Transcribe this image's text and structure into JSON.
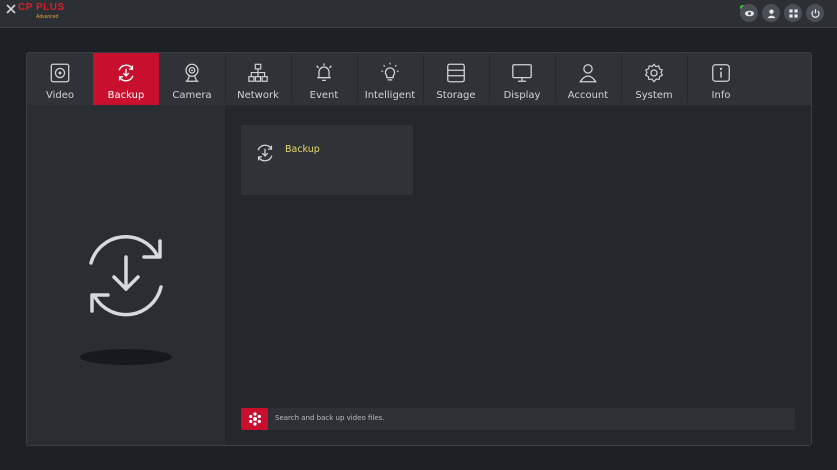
{
  "app": {
    "brand": "CP PLUS",
    "brand_sub": "Advanced"
  },
  "topbar": {
    "buttons": [
      {
        "icon": "eye-icon"
      },
      {
        "icon": "user-icon"
      },
      {
        "icon": "grid-icon"
      },
      {
        "icon": "power-icon"
      }
    ],
    "status_color": "#3ec93e"
  },
  "tabs": [
    {
      "label": "Video",
      "icon": "video-icon",
      "active": false
    },
    {
      "label": "Backup",
      "icon": "backup-icon",
      "active": true
    },
    {
      "label": "Camera",
      "icon": "camera-icon",
      "active": false
    },
    {
      "label": "Network",
      "icon": "network-icon",
      "active": false
    },
    {
      "label": "Event",
      "icon": "event-icon",
      "active": false
    },
    {
      "label": "Intelligent",
      "icon": "intelligent-icon",
      "active": false
    },
    {
      "label": "Storage",
      "icon": "storage-icon",
      "active": false
    },
    {
      "label": "Display",
      "icon": "display-icon",
      "active": false
    },
    {
      "label": "Account",
      "icon": "account-icon",
      "active": false
    },
    {
      "label": "System",
      "icon": "system-icon",
      "active": false
    },
    {
      "label": "Info",
      "icon": "info-icon",
      "active": false
    }
  ],
  "content": {
    "card_label": "Backup",
    "hint": "Search and back up video files."
  },
  "colors": {
    "accent": "#c8102e",
    "card_label": "#e8d86a"
  }
}
